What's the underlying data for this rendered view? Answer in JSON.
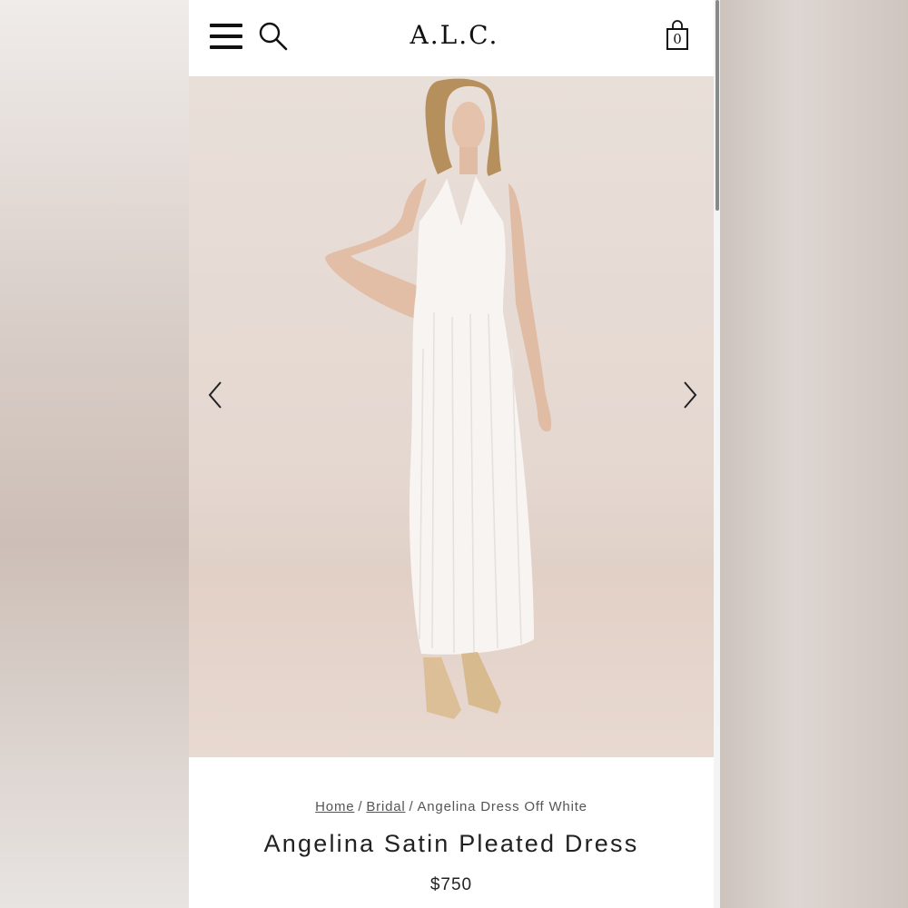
{
  "header": {
    "logo": "A.L.C.",
    "bag_count": "0",
    "icons": [
      "menu-icon",
      "search-icon",
      "shopping-bag-icon"
    ]
  },
  "gallery": {
    "image_alt": "Model wearing white pleated halter maxi dress",
    "icons": [
      "chevron-left-icon",
      "chevron-right-icon"
    ]
  },
  "breadcrumb": {
    "home": "Home",
    "sep1": "/",
    "bridal": "Bridal",
    "sep2": "/",
    "current": "Angelina Dress Off White"
  },
  "product": {
    "title": "Angelina Satin Pleated Dress",
    "price": "$750"
  },
  "colors": {
    "background": "#ffffff",
    "text": "#222222",
    "hero_wall": "#e9dfd9"
  }
}
